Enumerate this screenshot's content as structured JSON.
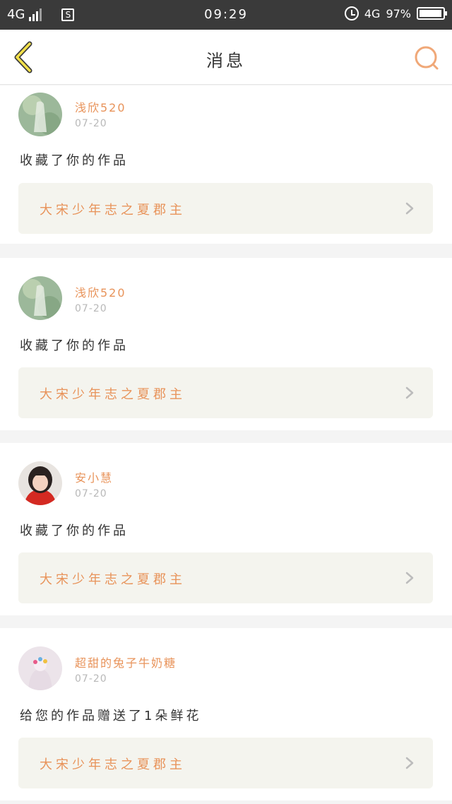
{
  "status_bar": {
    "network_left": "4G",
    "sim_icon_label": "S",
    "time": "09:29",
    "network_right": "4G",
    "battery_text": "97%",
    "battery_level": 0.97
  },
  "nav": {
    "title": "消息",
    "back_icon": "chevron-left-icon",
    "search_icon": "search-icon"
  },
  "accent_color": "#e8935a",
  "notifications": [
    {
      "username": "浅欣520",
      "date": "07-20",
      "message": "收藏了你的作品",
      "work_title": "大宋少年志之夏郡主",
      "avatar": "avatar-green"
    },
    {
      "username": "浅欣520",
      "date": "07-20",
      "message": "收藏了你的作品",
      "work_title": "大宋少年志之夏郡主",
      "avatar": "avatar-green"
    },
    {
      "username": "安小慧",
      "date": "07-20",
      "message": "收藏了你的作品",
      "work_title": "大宋少年志之夏郡主",
      "avatar": "avatar-red"
    },
    {
      "username": "超甜的兔子牛奶糖",
      "date": "07-20",
      "message": "给您的作品赠送了1朵鲜花",
      "work_title": "大宋少年志之夏郡主",
      "avatar": "avatar-pink"
    }
  ]
}
